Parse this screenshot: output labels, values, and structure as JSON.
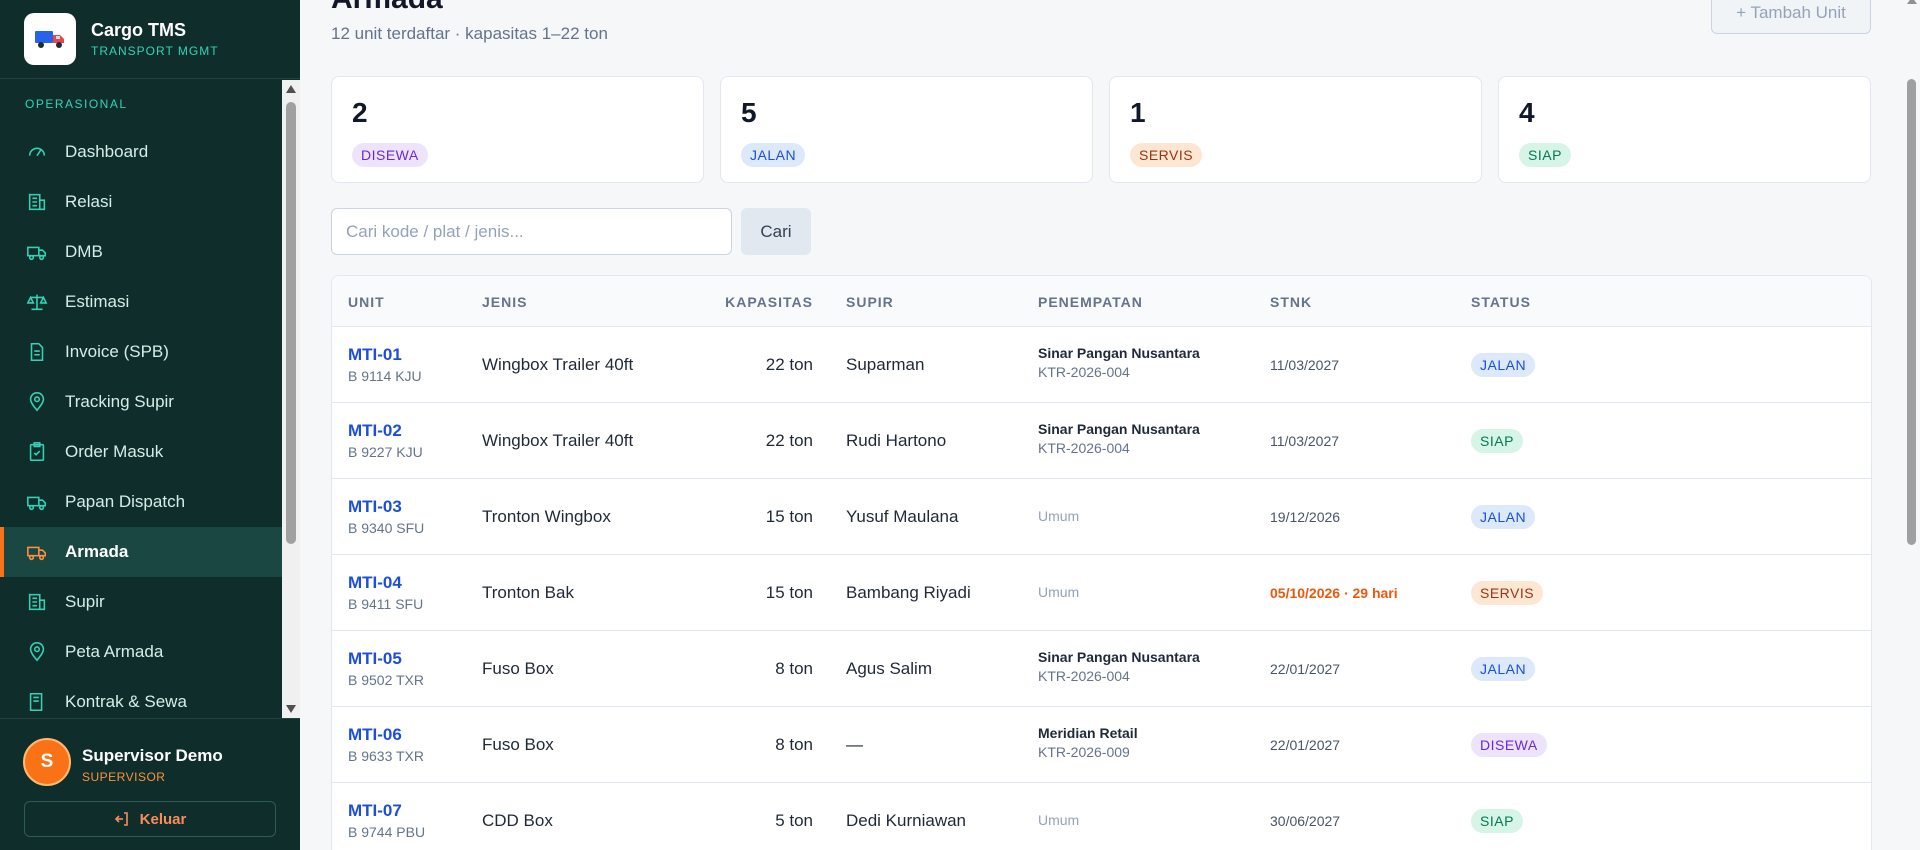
{
  "brand": {
    "name": "Cargo TMS",
    "subtitle": "TRANSPORT MGMT"
  },
  "sidebar": {
    "section": "OPERASIONAL",
    "items": [
      {
        "label": "Dashboard",
        "icon": "gauge-icon"
      },
      {
        "label": "Relasi",
        "icon": "building-icon"
      },
      {
        "label": "DMB",
        "icon": "truck-icon"
      },
      {
        "label": "Estimasi",
        "icon": "scale-icon"
      },
      {
        "label": "Invoice (SPB)",
        "icon": "document-icon"
      },
      {
        "label": "Tracking Supir",
        "icon": "map-pin-icon"
      },
      {
        "label": "Order Masuk",
        "icon": "clipboard-icon"
      },
      {
        "label": "Papan Dispatch",
        "icon": "truck-icon"
      },
      {
        "label": "Armada",
        "icon": "truck-icon",
        "active": true
      },
      {
        "label": "Supir",
        "icon": "building-icon"
      },
      {
        "label": "Peta Armada",
        "icon": "map-pin-icon"
      },
      {
        "label": "Kontrak & Sewa",
        "icon": "book-icon"
      }
    ]
  },
  "user": {
    "initial": "S",
    "name": "Supervisor Demo",
    "role": "SUPERVISOR",
    "logout_label": "Keluar"
  },
  "header": {
    "title": "Armada",
    "subtitle": "12 unit terdaftar · kapasitas 1–22 ton",
    "add_button": "+ Tambah Unit"
  },
  "stats": [
    {
      "value": "2",
      "label": "DISEWA",
      "kind": "disewa"
    },
    {
      "value": "5",
      "label": "JALAN",
      "kind": "jalan"
    },
    {
      "value": "1",
      "label": "SERVIS",
      "kind": "servis"
    },
    {
      "value": "4",
      "label": "SIAP",
      "kind": "siap"
    }
  ],
  "search": {
    "placeholder": "Cari kode / plat / jenis...",
    "value": "",
    "button": "Cari"
  },
  "table": {
    "columns": [
      "UNIT",
      "JENIS",
      "KAPASITAS",
      "SUPIR",
      "PENEMPATAN",
      "STNK",
      "STATUS"
    ],
    "rows": [
      {
        "code": "MTI-01",
        "plate": "B 9114 KJU",
        "type": "Wingbox Trailer 40ft",
        "capacity": "22 ton",
        "driver": "Suparman",
        "place_name": "Sinar Pangan Nusantara",
        "place_code": "KTR-2026-004",
        "stnk": "11/03/2027",
        "stnk_warn": false,
        "status": "JALAN",
        "status_kind": "jalan"
      },
      {
        "code": "MTI-02",
        "plate": "B 9227 KJU",
        "type": "Wingbox Trailer 40ft",
        "capacity": "22 ton",
        "driver": "Rudi Hartono",
        "place_name": "Sinar Pangan Nusantara",
        "place_code": "KTR-2026-004",
        "stnk": "11/03/2027",
        "stnk_warn": false,
        "status": "SIAP",
        "status_kind": "siap"
      },
      {
        "code": "MTI-03",
        "plate": "B 9340 SFU",
        "type": "Tronton Wingbox",
        "capacity": "15 ton",
        "driver": "Yusuf Maulana",
        "place_name": "Umum",
        "place_code": "",
        "stnk": "19/12/2026",
        "stnk_warn": false,
        "status": "JALAN",
        "status_kind": "jalan"
      },
      {
        "code": "MTI-04",
        "plate": "B 9411 SFU",
        "type": "Tronton Bak",
        "capacity": "15 ton",
        "driver": "Bambang Riyadi",
        "place_name": "Umum",
        "place_code": "",
        "stnk": "05/10/2026 · 29 hari",
        "stnk_warn": true,
        "status": "SERVIS",
        "status_kind": "servis"
      },
      {
        "code": "MTI-05",
        "plate": "B 9502 TXR",
        "type": "Fuso Box",
        "capacity": "8 ton",
        "driver": "Agus Salim",
        "place_name": "Sinar Pangan Nusantara",
        "place_code": "KTR-2026-004",
        "stnk": "22/01/2027",
        "stnk_warn": false,
        "status": "JALAN",
        "status_kind": "jalan"
      },
      {
        "code": "MTI-06",
        "plate": "B 9633 TXR",
        "type": "Fuso Box",
        "capacity": "8 ton",
        "driver": "—",
        "place_name": "Meridian Retail",
        "place_code": "KTR-2026-009",
        "stnk": "22/01/2027",
        "stnk_warn": false,
        "status": "DISEWA",
        "status_kind": "disewa"
      },
      {
        "code": "MTI-07",
        "plate": "B 9744 PBU",
        "type": "CDD Box",
        "capacity": "5 ton",
        "driver": "Dedi Kurniawan",
        "place_name": "Umum",
        "place_code": "",
        "stnk": "30/06/2027",
        "stnk_warn": false,
        "status": "SIAP",
        "status_kind": "siap"
      }
    ]
  }
}
